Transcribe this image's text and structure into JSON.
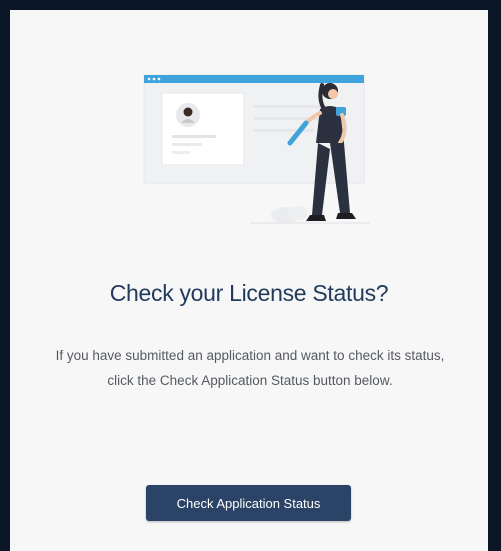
{
  "card": {
    "title": "Check your License Status?",
    "description": "If you have submitted an application and want to check its status, click the Check Application Status button below.",
    "button_label": "Check Application Status"
  },
  "colors": {
    "title": "#223a5c",
    "button": "#2a4366",
    "accent": "#3fa3dc",
    "frame": "#0b1626"
  },
  "icons": {
    "illustration": "woman-with-pencil-profile-card-illustration"
  }
}
